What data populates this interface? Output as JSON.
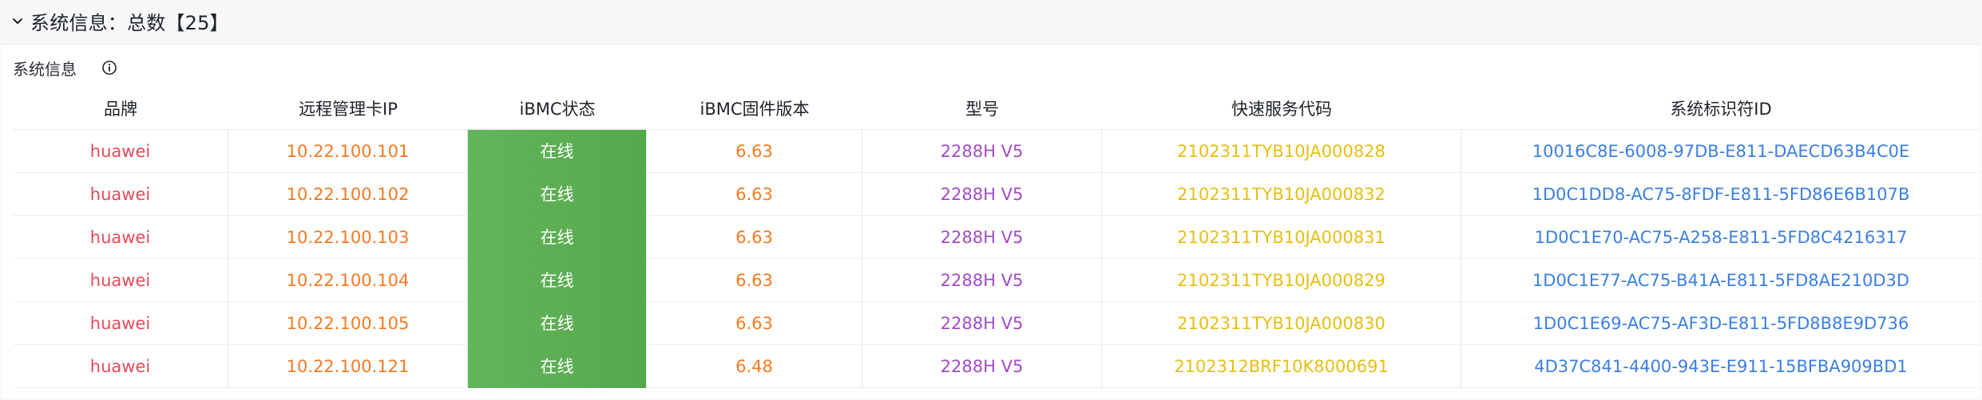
{
  "section": {
    "title": "系统信息：总数【25】"
  },
  "panel": {
    "title": "系统信息"
  },
  "colors": {
    "brand": "#e64a5a",
    "ip": "#f57a22",
    "status_bg": "#5aad52",
    "firmware": "#f57a22",
    "model": "#a24bc8",
    "service_code": "#e6bf12",
    "system_id": "#3b7fe0"
  },
  "table": {
    "columns": [
      "品牌",
      "远程管理卡IP",
      "iBMC状态",
      "iBMC固件版本",
      "型号",
      "快速服务代码",
      "系统标识符ID"
    ],
    "rows": [
      {
        "brand": "huawei",
        "ip": "10.22.100.101",
        "status": "在线",
        "firmware": "6.63",
        "model": "2288H V5",
        "service_code": "2102311TYB10JA000828",
        "system_id": "10016C8E-6008-97DB-E811-DAECD63B4C0E"
      },
      {
        "brand": "huawei",
        "ip": "10.22.100.102",
        "status": "在线",
        "firmware": "6.63",
        "model": "2288H V5",
        "service_code": "2102311TYB10JA000832",
        "system_id": "1D0C1DD8-AC75-8FDF-E811-5FD86E6B107B"
      },
      {
        "brand": "huawei",
        "ip": "10.22.100.103",
        "status": "在线",
        "firmware": "6.63",
        "model": "2288H V5",
        "service_code": "2102311TYB10JA000831",
        "system_id": "1D0C1E70-AC75-A258-E811-5FD8C4216317"
      },
      {
        "brand": "huawei",
        "ip": "10.22.100.104",
        "status": "在线",
        "firmware": "6.63",
        "model": "2288H V5",
        "service_code": "2102311TYB10JA000829",
        "system_id": "1D0C1E77-AC75-B41A-E811-5FD8AE210D3D"
      },
      {
        "brand": "huawei",
        "ip": "10.22.100.105",
        "status": "在线",
        "firmware": "6.63",
        "model": "2288H V5",
        "service_code": "2102311TYB10JA000830",
        "system_id": "1D0C1E69-AC75-AF3D-E811-5FD8B8E9D736"
      },
      {
        "brand": "huawei",
        "ip": "10.22.100.121",
        "status": "在线",
        "firmware": "6.48",
        "model": "2288H V5",
        "service_code": "2102312BRF10K8000691",
        "system_id": "4D37C841-4400-943E-E911-15BFBA909BD1"
      }
    ]
  }
}
